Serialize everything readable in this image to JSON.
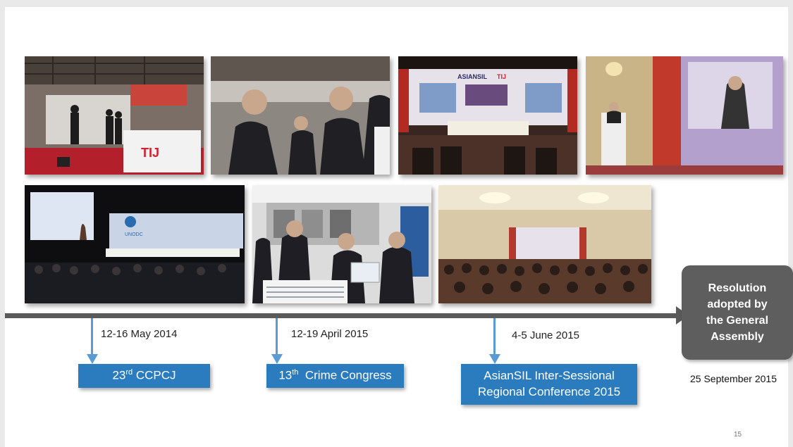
{
  "photos": [
    {
      "name": "photo-tij-booth",
      "logo_text": "TIJ"
    },
    {
      "name": "photo-delegates-meeting"
    },
    {
      "name": "photo-asiansil-conference-panel",
      "banner_text": "ASIANSIL",
      "logo_text": "TIJ"
    },
    {
      "name": "photo-speaker-podium"
    },
    {
      "name": "photo-unodc-plenary",
      "logo_text": "UNODC"
    },
    {
      "name": "photo-exhibition-tablet"
    },
    {
      "name": "photo-ballroom-audience"
    }
  ],
  "timeline": {
    "events": [
      {
        "date": "12-16 May 2014",
        "label_main": "23",
        "label_sup": "rd",
        "label_rest": " CCPCJ"
      },
      {
        "date": "12-19 April 2015",
        "label_main": "13",
        "label_sup": "th",
        "label_rest": "  Crime Congress"
      },
      {
        "date": "4-5 June 2015",
        "label_line1": "AsianSIL Inter-Sessional",
        "label_line2": "Regional Conference 2015"
      }
    ],
    "resolution": {
      "line1": "Resolution",
      "line2": "adopted by",
      "line3": "the General",
      "line4": "Assembly",
      "date": "25 September 2015"
    }
  },
  "page_number": "15",
  "colors": {
    "event_box": "#2b7cbf",
    "arrow": "#5b9bd5",
    "timeline": "#5a5a5a",
    "resolution_box": "#5e5e5e"
  }
}
